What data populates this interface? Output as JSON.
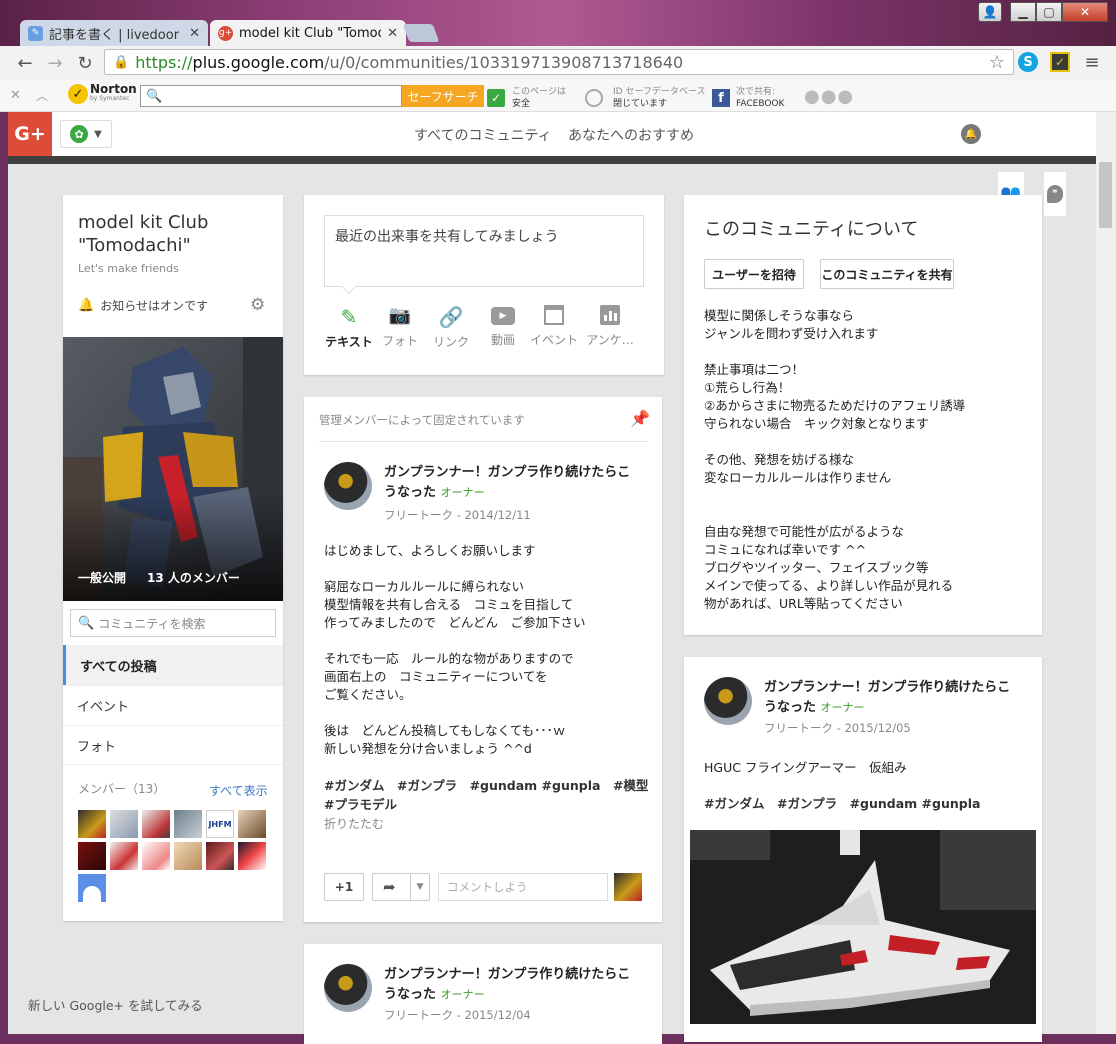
{
  "browser": {
    "tabs": [
      {
        "title": "記事を書く | livedoor Blo",
        "active": false
      },
      {
        "title": "model kit Club \"Tomoda",
        "active": true
      }
    ],
    "url_scheme": "https://",
    "url_host": "plus.google.com",
    "url_path": "/u/0/communities/103319713908713718640"
  },
  "norton": {
    "brand": "Norton",
    "brand_sub": "by Symantec",
    "search_button": "セーフサーチ",
    "page_status_label": "このページは",
    "page_status_value": "安全",
    "idsafe_label": "ID セーフデータベース",
    "idsafe_value": "閉じています",
    "share_label": "次で共有:",
    "share_value": "FACEBOOK"
  },
  "gplus": {
    "logo": "G+",
    "nav": [
      "すべてのコミュニティ",
      "あなたへのおすすめ"
    ]
  },
  "community": {
    "name": "model kit Club \"Tomodachi\"",
    "tagline": "Let's make friends",
    "notifications": "お知らせはオンです",
    "visibility": "一般公開",
    "member_count": "13 人のメンバー",
    "search_placeholder": "コミュニティを検索",
    "sections": [
      "すべての投稿",
      "イベント",
      "フォト"
    ],
    "members_label": "メンバー（13）",
    "see_all": "すべて表示"
  },
  "composer": {
    "placeholder": "最近の出来事を共有してみましょう",
    "actions": [
      "テキスト",
      "フォト",
      "リンク",
      "動画",
      "イベント",
      "アンケ…"
    ]
  },
  "pinned_post": {
    "pinned_note": "管理メンバーによって固定されています",
    "author": "ガンプランナー！ガンプラ作り続けたらこうなった",
    "role": "オーナー",
    "category_date": "フリートーク - 2014/12/11",
    "body": "はじめまして、よろしくお願いします\n\n窮屈なローカルルールに縛られない\n模型情報を共有し合える　コミュを目指して\n作ってみましたので　どんどん　ご参加下さい\n\nそれでも一応　ルール的な物がありますので\n画面右上の　コミュニティーについてを\nご覧ください。\n\n後は　どんどん投稿してもしなくても･･･ｗ\n新しい発想を分け合いましょう ^^d",
    "hashtags": "#ガンダム　#ガンプラ　#gundam #gunpla　#模型\n#プラモデル",
    "collapse": "折りたたむ",
    "plus_one": "+1",
    "comment_placeholder": "コメントしよう"
  },
  "post2": {
    "author": "ガンプランナー！ガンプラ作り続けたらこうなった",
    "role": "オーナー",
    "category_date": "フリートーク - 2015/12/04"
  },
  "about": {
    "title": "このコミュニティについて",
    "invite_button": "ユーザーを招待",
    "share_button": "このコミュニティを共有",
    "text": "模型に関係しそうな事なら\nジャンルを問わず受け入れます\n\n禁止事項は二つ！\n①荒らし行為！\n②あからさまに物売るためだけのアフェリ誘導\n守られない場合　キック対象となります\n\nその他、発想を妨げる様な\n変なローカルルールは作りません\n\n\n自由な発想で可能性が広がるような\nコミュになれば幸いです ^^\nブログやツイッター、フェイスブック等\nメインで使ってる、より詳しい作品が見れる\n物があれば、URL等貼ってください"
  },
  "post3": {
    "author": "ガンプランナー！ガンプラ作り続けたらこうなった",
    "role": "オーナー",
    "category_date": "フリートーク - 2015/12/05",
    "body": "HGUC フライングアーマー　仮組み",
    "hashtags": "#ガンダム　#ガンプラ　#gundam #gunpla"
  },
  "footer_link": "新しい Google+ を試してみる"
}
